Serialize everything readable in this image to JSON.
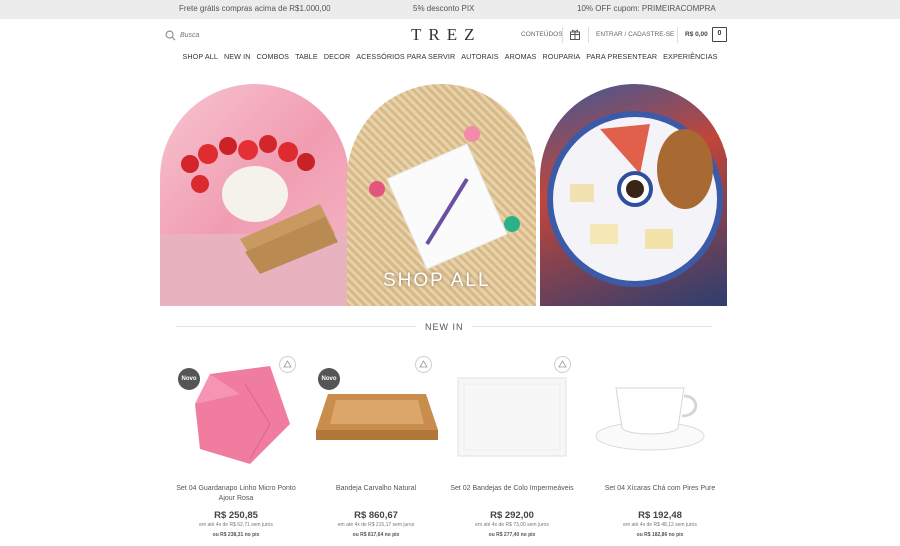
{
  "promo": {
    "shipping": "Frete grátis compras acima de R$1.000,00",
    "pix": "5% desconto PIX",
    "coupon": "10% OFF cupom: PRIMEIRACOMPRA"
  },
  "header": {
    "search_placeholder": "Busca",
    "logo": "TREZ",
    "conteudos": "CONTEÚDOS",
    "login": "ENTRAR / CADASTRE-SE",
    "cart_total": "R$ 0,00",
    "cart_count": "0"
  },
  "nav": [
    "SHOP ALL",
    "NEW IN",
    "COMBOS",
    "TABLE",
    "DECOR",
    "ACESSÓRIOS PARA SERVIR",
    "AUTORAIS",
    "AROMAS",
    "ROUPARIA",
    "PARA PRESENTEAR",
    "EXPERIÊNCIAS"
  ],
  "hero": {
    "cta": "SHOP ALL"
  },
  "section": {
    "title": "NEW IN"
  },
  "products": [
    {
      "badge": "Novo",
      "name": "Set 04 Guardanapo Linho Micro Ponto Ajour Rosa",
      "price": "R$ 250,85",
      "installments": "em até 4x de R$ 62,71 sem juros",
      "pix": "ou R$ 238,31 no pix"
    },
    {
      "badge": "Novo",
      "name": "Bandeja Carvalho Natural",
      "price": "R$ 860,67",
      "installments": "em até 4x de R$ 215,17 sem juros",
      "pix": "ou R$ 817,64 no pix"
    },
    {
      "badge": "",
      "name": "Set 02 Bandejas de Colo Impermeáveis",
      "price": "R$ 292,00",
      "installments": "em até 4x de R$ 73,00 sem juros",
      "pix": "ou R$ 277,40 no pix"
    },
    {
      "badge": "",
      "name": "Set 04 Xícaras Chá com Pires Pure",
      "price": "R$ 192,48",
      "installments": "em até 4x de R$ 48,12 sem juros",
      "pix": "ou R$ 182,86 no pix"
    }
  ]
}
